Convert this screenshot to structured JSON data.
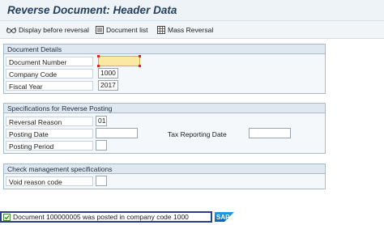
{
  "title": "Reverse Document: Header Data",
  "toolbar": {
    "display_before_reversal": "Display before reversal",
    "document_list": "Document list",
    "mass_reversal": "Mass Reversal"
  },
  "document_details": {
    "heading": "Document Details",
    "document_number_label": "Document Number",
    "document_number_value": "",
    "company_code_label": "Company Code",
    "company_code_value": "1000",
    "fiscal_year_label": "Fiscal Year",
    "fiscal_year_value": "2017"
  },
  "specifications": {
    "heading": "Specifications for Reverse Posting",
    "reversal_reason_label": "Reversal Reason",
    "reversal_reason_value": "01",
    "posting_date_label": "Posting Date",
    "posting_date_value": "",
    "tax_reporting_date_label": "Tax Reporting Date",
    "tax_reporting_date_value": "",
    "posting_period_label": "Posting Period",
    "posting_period_value": ""
  },
  "check_management": {
    "heading": "Check management specifications",
    "void_reason_code_label": "Void reason code",
    "void_reason_code_value": ""
  },
  "status": {
    "message": "Document 100000005 was posted in company code 1000"
  },
  "logo": {
    "text": "SAP"
  },
  "colors": {
    "title": "#23405c",
    "focus_field": "#fbe9a3",
    "status_border": "#2a3e8c",
    "sap_blue": "#0a6ed1"
  }
}
